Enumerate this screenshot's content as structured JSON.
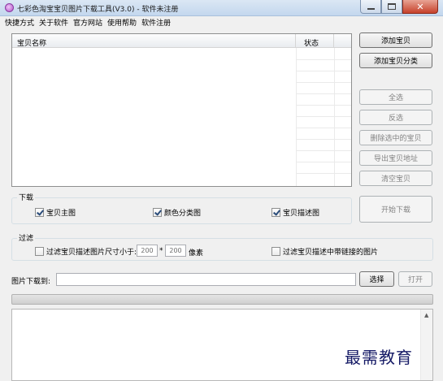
{
  "window": {
    "title": "七彩色淘宝宝贝图片下载工具(V3.0) - 软件未注册",
    "close_glyph": "✕"
  },
  "menu": [
    "快捷方式",
    "关于软件",
    "官方网站",
    "使用帮助",
    "软件注册"
  ],
  "list": {
    "columns": [
      "宝贝名称",
      "状态"
    ]
  },
  "buttons": {
    "add_item": "添加宝贝",
    "add_category": "添加宝贝分类",
    "select_all": "全选",
    "invert": "反选",
    "delete_selected": "删除选中的宝贝",
    "export_urls": "导出宝贝地址",
    "clear": "清空宝贝",
    "start_download": "开始下载",
    "choose": "选择",
    "open": "打开"
  },
  "download_group": {
    "label": "下载",
    "options": [
      {
        "label": "宝贝主图",
        "checked": true
      },
      {
        "label": "颜色分类图",
        "checked": true
      },
      {
        "label": "宝贝描述图",
        "checked": true
      }
    ]
  },
  "filter_group": {
    "label": "过滤",
    "size_filter": {
      "label": "过滤宝贝描述图片尺寸小于:",
      "width": "200",
      "times": "*",
      "height": "200",
      "unit": "像素",
      "checked": false
    },
    "link_filter": {
      "label": "过滤宝贝描述中带链接的图片",
      "checked": false
    }
  },
  "save_path": {
    "label": "图片下载到:",
    "value": ""
  },
  "log": {
    "scroll_up_glyph": "▲"
  },
  "watermark": "最需教育"
}
